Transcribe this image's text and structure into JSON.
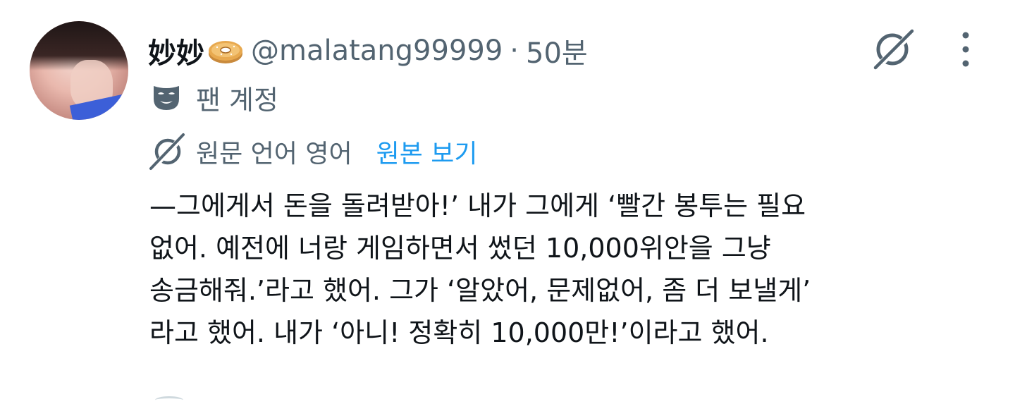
{
  "tweet": {
    "author": {
      "display_name": "妙妙",
      "handle": "@malatang99999",
      "separator": "·",
      "time": "50분",
      "name_emoji": "bagel-emoji"
    },
    "fan_account": {
      "icon": "mask-icon",
      "label": "팬 계정"
    },
    "translation": {
      "icon": "grok-icon",
      "label": "원문 언어 영어",
      "link": "원본 보기"
    },
    "body_lines": [
      "—그에게서 돈을 돌려받아!’ 내가 그에게 ‘빨간 봉투는 필요",
      "없어. 예전에 너랑 게임하면서 썼던 10,000위안을 그냥",
      "송금해줘.’라고 했어. 그가 ‘알았어, 문제없어, 좀 더 보낼게’",
      "라고 했어. 내가 ‘아니! 정확히 10,000만!’이라고 했어."
    ],
    "actions": {
      "grok": "grok-icon",
      "more": "more-vertical-icon"
    }
  },
  "colors": {
    "text_primary": "#0f1419",
    "text_secondary": "#536471",
    "link": "#1d9bf0"
  }
}
